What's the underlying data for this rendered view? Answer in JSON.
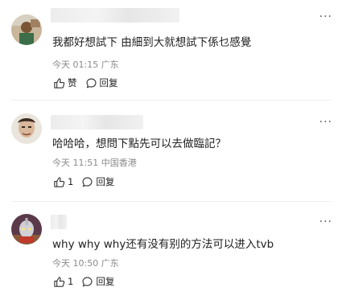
{
  "comments": [
    {
      "text": "我都好想試下 由細到大就想試下係乜感覺",
      "time": "今天 01:15",
      "location": "广东",
      "like_label": "赞",
      "reply_label": "回复",
      "more": "···"
    },
    {
      "text": "哈哈哈，想問下點先可以去做臨記？",
      "time": "今天 11:51",
      "location": "中国香港",
      "like_label": "1",
      "reply_label": "回复",
      "more": "···"
    },
    {
      "text": "why why why还有没有别的方法可以进入tvb",
      "time": "今天 10:50",
      "location": "广东",
      "like_label": "1",
      "reply_label": "回复",
      "more": "···"
    }
  ],
  "icons": {
    "like": "thumbs-up-icon",
    "reply": "chat-bubble-icon",
    "more": "more-dots-icon"
  }
}
